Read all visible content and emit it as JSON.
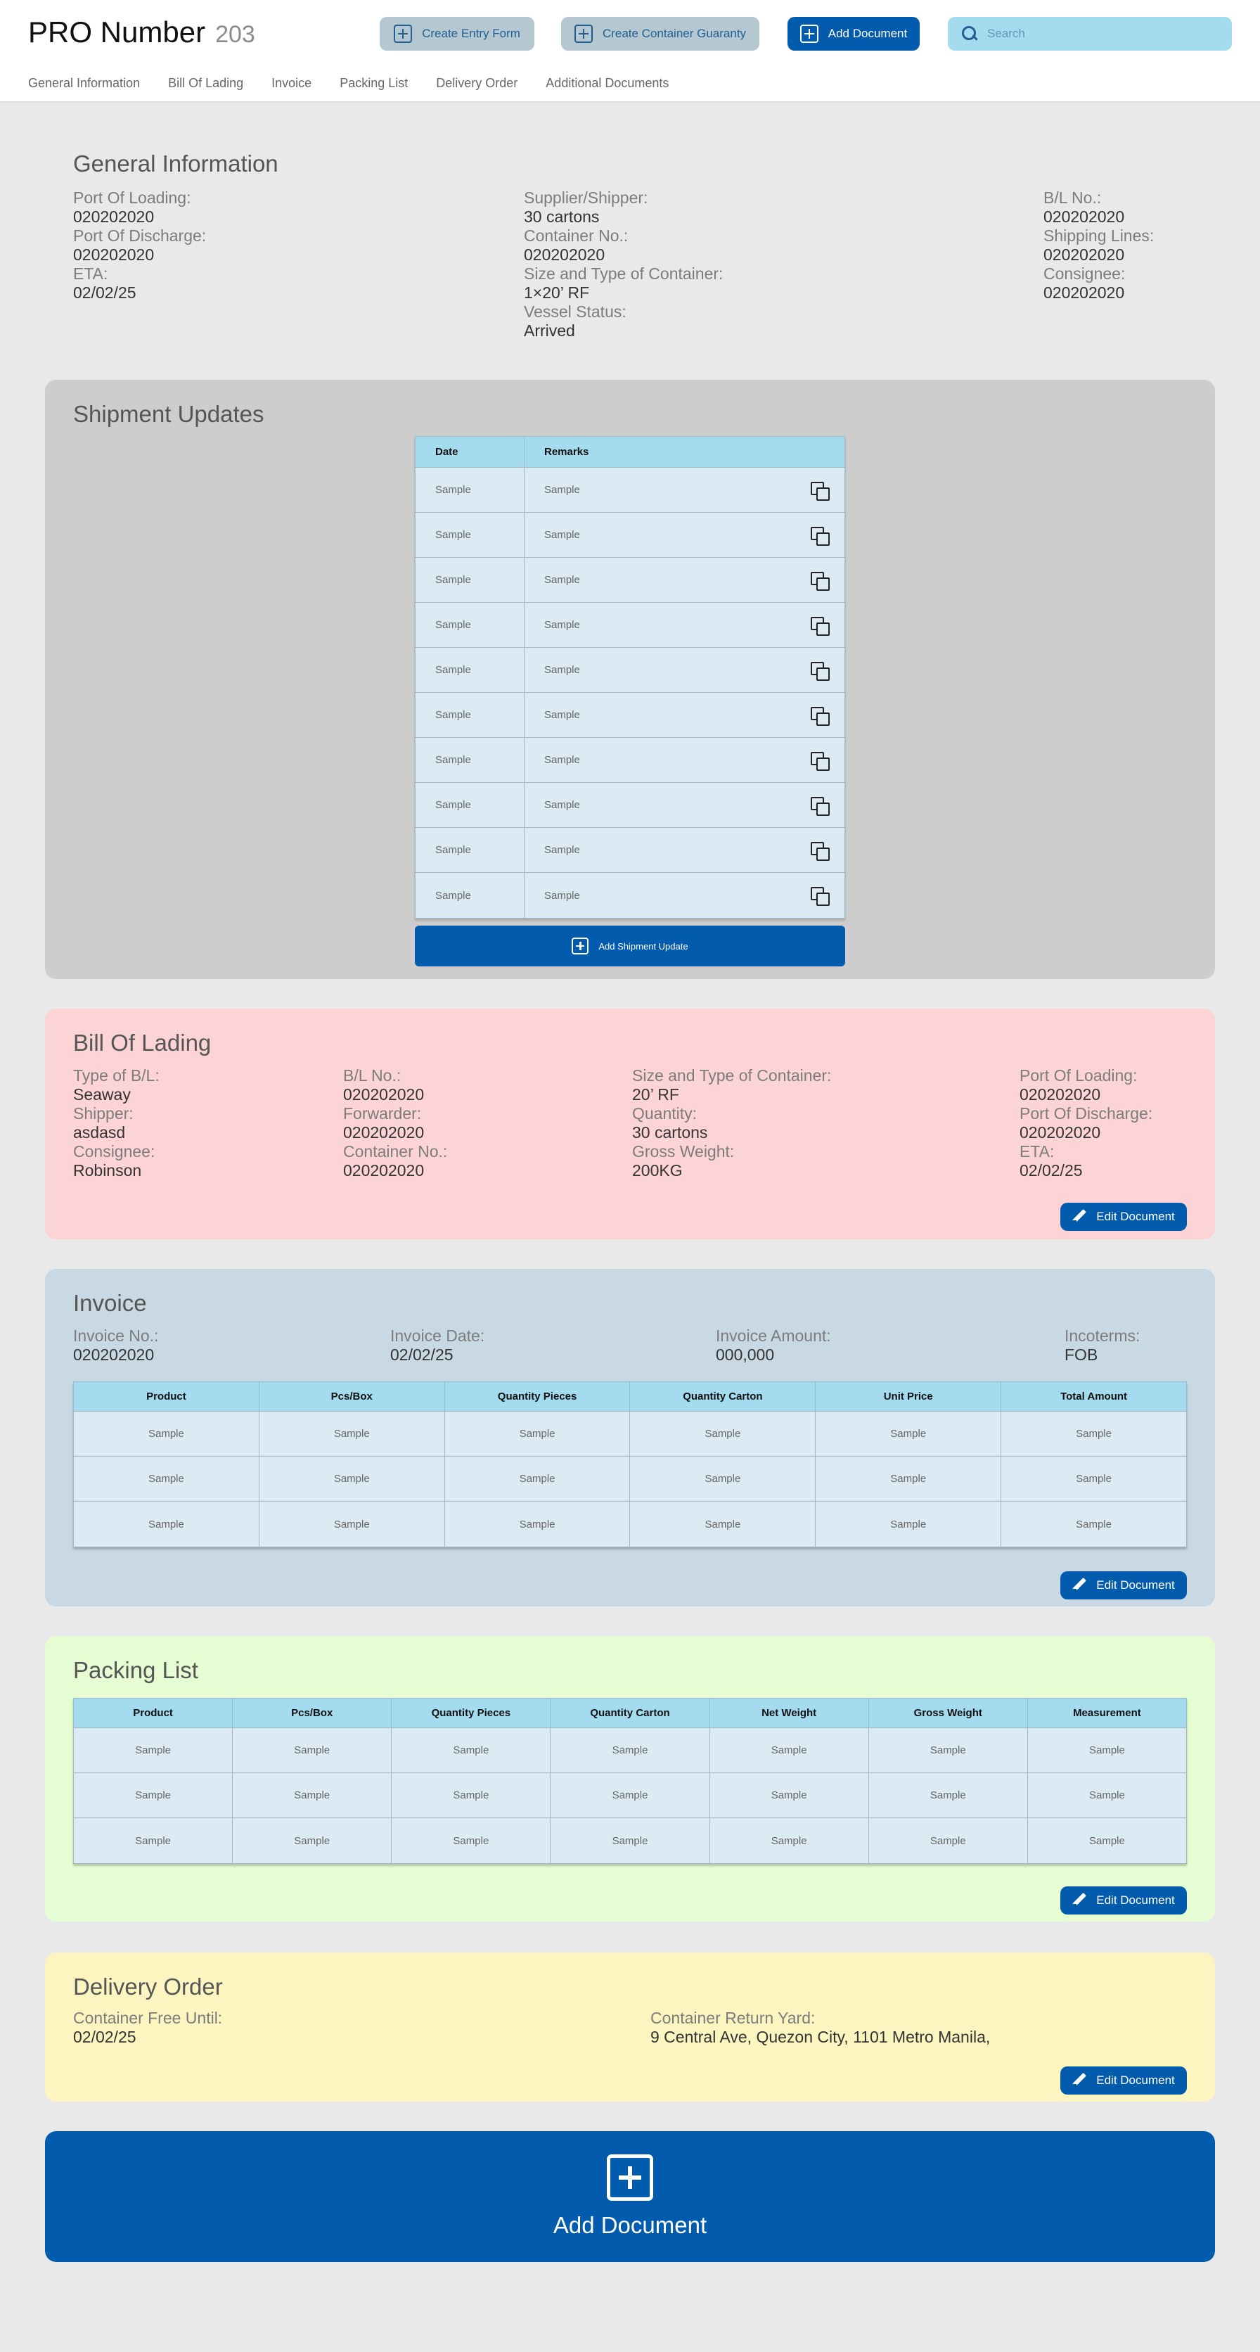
{
  "header": {
    "title": "PRO Number",
    "number": "203",
    "create_entry_label": "Create Entry Form",
    "create_container_label": "Create Container Guaranty",
    "add_document_label": "Add Document",
    "search_placeholder": "Search",
    "tabs": [
      "General Information",
      "Bill Of Lading",
      "Invoice",
      "Packing List",
      "Delivery Order",
      "Additional Documents"
    ]
  },
  "general": {
    "title": "General Information",
    "port_of_loading_label": "Port Of Loading:",
    "port_of_loading": "020202020",
    "port_of_discharge_label": "Port Of Discharge:",
    "port_of_discharge": "020202020",
    "eta_label": "ETA:",
    "eta": "02/02/25",
    "supplier_label": "Supplier/Shipper:",
    "supplier": "30 cartons",
    "container_no_label": "Container No.:",
    "container_no": "020202020",
    "size_type_label": "Size and Type of Container:",
    "size_type": "1×20’ RF",
    "vessel_status_label": "Vessel Status:",
    "vessel_status": "Arrived",
    "bl_no_label": "B/L No.:",
    "bl_no": "020202020",
    "shipping_lines_label": "Shipping Lines:",
    "shipping_lines": "020202020",
    "consignee_label": "Consignee:",
    "consignee": "020202020"
  },
  "shipment": {
    "title": "Shipment Updates",
    "col_date": "Date",
    "col_remarks": "Remarks",
    "rows": [
      {
        "date": "Sample",
        "remarks": "Sample"
      },
      {
        "date": "Sample",
        "remarks": "Sample"
      },
      {
        "date": "Sample",
        "remarks": "Sample"
      },
      {
        "date": "Sample",
        "remarks": "Sample"
      },
      {
        "date": "Sample",
        "remarks": "Sample"
      },
      {
        "date": "Sample",
        "remarks": "Sample"
      },
      {
        "date": "Sample",
        "remarks": "Sample"
      },
      {
        "date": "Sample",
        "remarks": "Sample"
      },
      {
        "date": "Sample",
        "remarks": "Sample"
      },
      {
        "date": "Sample",
        "remarks": "Sample"
      }
    ],
    "add_label": "Add Shipment Update"
  },
  "bol": {
    "title": "Bill Of Lading",
    "type_label": "Type of B/L:",
    "type": "Seaway",
    "shipper_label": "Shipper:",
    "shipper": "asdasd",
    "consignee_label": "Consignee:",
    "consignee": "Robinson",
    "bl_no_label": "B/L No.:",
    "bl_no": "020202020",
    "forwarder_label": "Forwarder:",
    "forwarder": "020202020",
    "container_no_label": "Container No.:",
    "container_no": "020202020",
    "size_type_label": "Size and Type of Container:",
    "size_type": "20’ RF",
    "quantity_label": "Quantity:",
    "quantity": "30 cartons",
    "gross_weight_label": "Gross Weight:",
    "gross_weight": "200KG",
    "port_loading_label": "Port Of Loading:",
    "port_loading": "020202020",
    "port_discharge_label": "Port Of Discharge:",
    "port_discharge": "020202020",
    "eta_label": "ETA:",
    "eta": "02/02/25",
    "edit_label": "Edit Document"
  },
  "invoice": {
    "title": "Invoice",
    "no_label": "Invoice No.:",
    "no": "020202020",
    "date_label": "Invoice Date:",
    "date": "02/02/25",
    "amount_label": "Invoice Amount:",
    "amount": "000,000",
    "incoterms_label": "Incoterms:",
    "incoterms": "FOB",
    "columns": [
      "Product",
      "Pcs/Box",
      "Quantity Pieces",
      "Quantity Carton",
      "Unit Price",
      "Total Amount"
    ],
    "rows": [
      [
        "Sample",
        "Sample",
        "Sample",
        "Sample",
        "Sample",
        "Sample"
      ],
      [
        "Sample",
        "Sample",
        "Sample",
        "Sample",
        "Sample",
        "Sample"
      ],
      [
        "Sample",
        "Sample",
        "Sample",
        "Sample",
        "Sample",
        "Sample"
      ]
    ],
    "edit_label": "Edit Document"
  },
  "packing": {
    "title": "Packing List",
    "columns": [
      "Product",
      "Pcs/Box",
      "Quantity Pieces",
      "Quantity Carton",
      "Net Weight",
      "Gross Weight",
      "Measurement"
    ],
    "rows": [
      [
        "Sample",
        "Sample",
        "Sample",
        "Sample",
        "Sample",
        "Sample",
        "Sample"
      ],
      [
        "Sample",
        "Sample",
        "Sample",
        "Sample",
        "Sample",
        "Sample",
        "Sample"
      ],
      [
        "Sample",
        "Sample",
        "Sample",
        "Sample",
        "Sample",
        "Sample",
        "Sample"
      ]
    ],
    "edit_label": "Edit Document"
  },
  "delivery": {
    "title": "Delivery Order",
    "free_until_label": "Container Free Until:",
    "free_until": "02/02/25",
    "return_yard_label": "Container Return Yard:",
    "return_yard": "9 Central Ave, Quezon City, 1101 Metro Manila,",
    "edit_label": "Edit Document"
  },
  "add_document": {
    "label": "Add Document"
  },
  "colors": {
    "primary": "#035bad",
    "table_header": "#a4dbee",
    "table_row": "#dcebf3",
    "shipment_bg": "#cdcdcd",
    "bol_bg": "#fdd4d5",
    "invoice_bg": "#c9d9e3",
    "packing_bg": "#e6fdd4",
    "delivery_bg": "#fcf5c0"
  },
  "icons": {
    "create": "plus-square-icon",
    "search": "search-icon",
    "copy": "copy-icon",
    "edit": "pencil-icon"
  }
}
